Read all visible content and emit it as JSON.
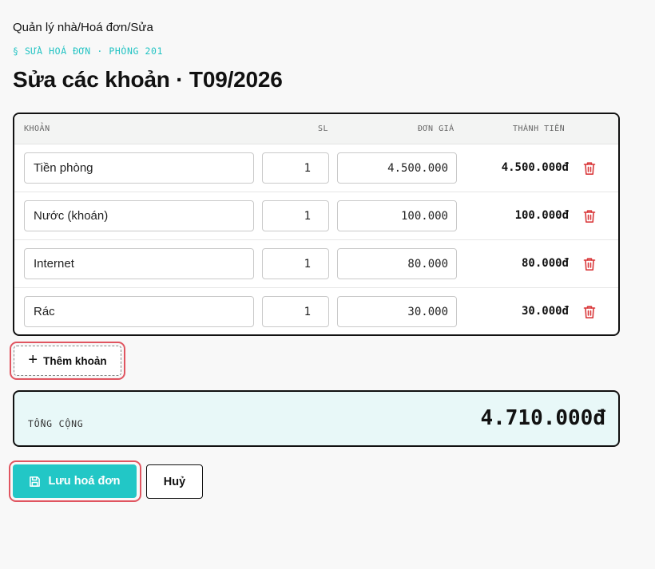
{
  "breadcrumb": "Quản lý nhà/Hoá đơn/Sửa",
  "eyebrow": "§ SỬA HOÁ ĐƠN · PHÒNG 201",
  "title": "Sửa các khoản · T09/2026",
  "table": {
    "headers": {
      "item": "KHOẢN",
      "qty": "SL",
      "price": "ĐƠN GIÁ",
      "total": "THÀNH TIỀN"
    },
    "rows": [
      {
        "name": "Tiền phòng",
        "qty": "1",
        "price": "4.500.000",
        "total": "4.500.000đ"
      },
      {
        "name": "Nước (khoán)",
        "qty": "1",
        "price": "100.000",
        "total": "100.000đ"
      },
      {
        "name": "Internet",
        "qty": "1",
        "price": "80.000",
        "total": "80.000đ"
      },
      {
        "name": "Rác",
        "qty": "1",
        "price": "30.000",
        "total": "30.000đ"
      }
    ]
  },
  "add_item": {
    "icon": "plus-icon",
    "label": "Thêm khoản"
  },
  "summary": {
    "label": "TỔNG CỘNG",
    "value": "4.710.000đ"
  },
  "actions": {
    "save_label": "Lưu hoá đơn",
    "save_icon": "floppy-disk-icon",
    "cancel_label": "Huỷ"
  },
  "colors": {
    "accent": "#22c7c6",
    "eyebrow": "#22c3c3",
    "danger": "#d9383a",
    "highlight": "#e05560",
    "total_bg": "#e8f8f8"
  }
}
